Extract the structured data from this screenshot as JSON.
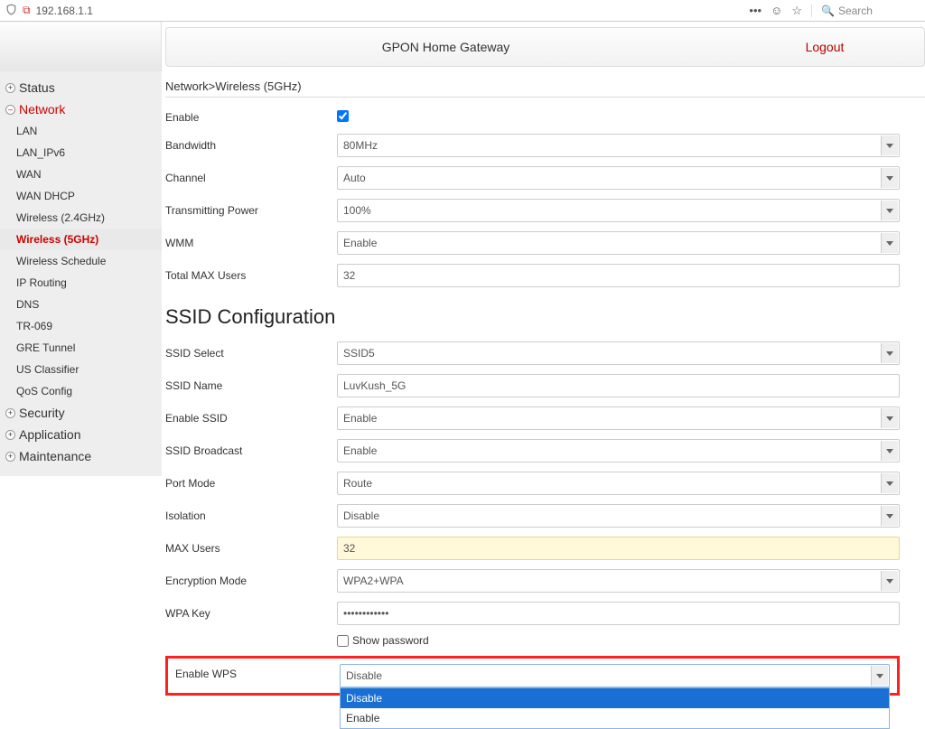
{
  "browser": {
    "url": "192.168.1.1",
    "search_placeholder": "Search"
  },
  "header": {
    "title": "GPON Home Gateway",
    "logout": "Logout"
  },
  "breadcrumb": "Network>Wireless (5GHz)",
  "nav": {
    "status": "Status",
    "network": "Network",
    "items": [
      "LAN",
      "LAN_IPv6",
      "WAN",
      "WAN DHCP",
      "Wireless (2.4GHz)",
      "Wireless (5GHz)",
      "Wireless Schedule",
      "IP Routing",
      "DNS",
      "TR-069",
      "GRE Tunnel",
      "US Classifier",
      "QoS Config"
    ],
    "security": "Security",
    "application": "Application",
    "maintenance": "Maintenance"
  },
  "form": {
    "enable_label": "Enable",
    "bandwidth_label": "Bandwidth",
    "bandwidth_value": "80MHz",
    "channel_label": "Channel",
    "channel_value": "Auto",
    "tx_label": "Transmitting Power",
    "tx_value": "100%",
    "wmm_label": "WMM",
    "wmm_value": "Enable",
    "total_label": "Total MAX Users",
    "total_value": "32"
  },
  "ssid_title": "SSID Configuration",
  "ssid": {
    "select_label": "SSID Select",
    "select_value": "SSID5",
    "name_label": "SSID Name",
    "name_value": "LuvKush_5G",
    "enable_label": "Enable SSID",
    "enable_value": "Enable",
    "broadcast_label": "SSID Broadcast",
    "broadcast_value": "Enable",
    "port_label": "Port Mode",
    "port_value": "Route",
    "isolation_label": "Isolation",
    "isolation_value": "Disable",
    "max_label": "MAX Users",
    "max_value": "32",
    "enc_label": "Encryption Mode",
    "enc_value": "WPA2+WPA",
    "wpa_label": "WPA Key",
    "wpa_value": "••••••••••••",
    "show_pw": "Show password",
    "wps_label": "Enable WPS",
    "wps_value": "Disable",
    "wps_options": [
      "Disable",
      "Enable"
    ]
  }
}
